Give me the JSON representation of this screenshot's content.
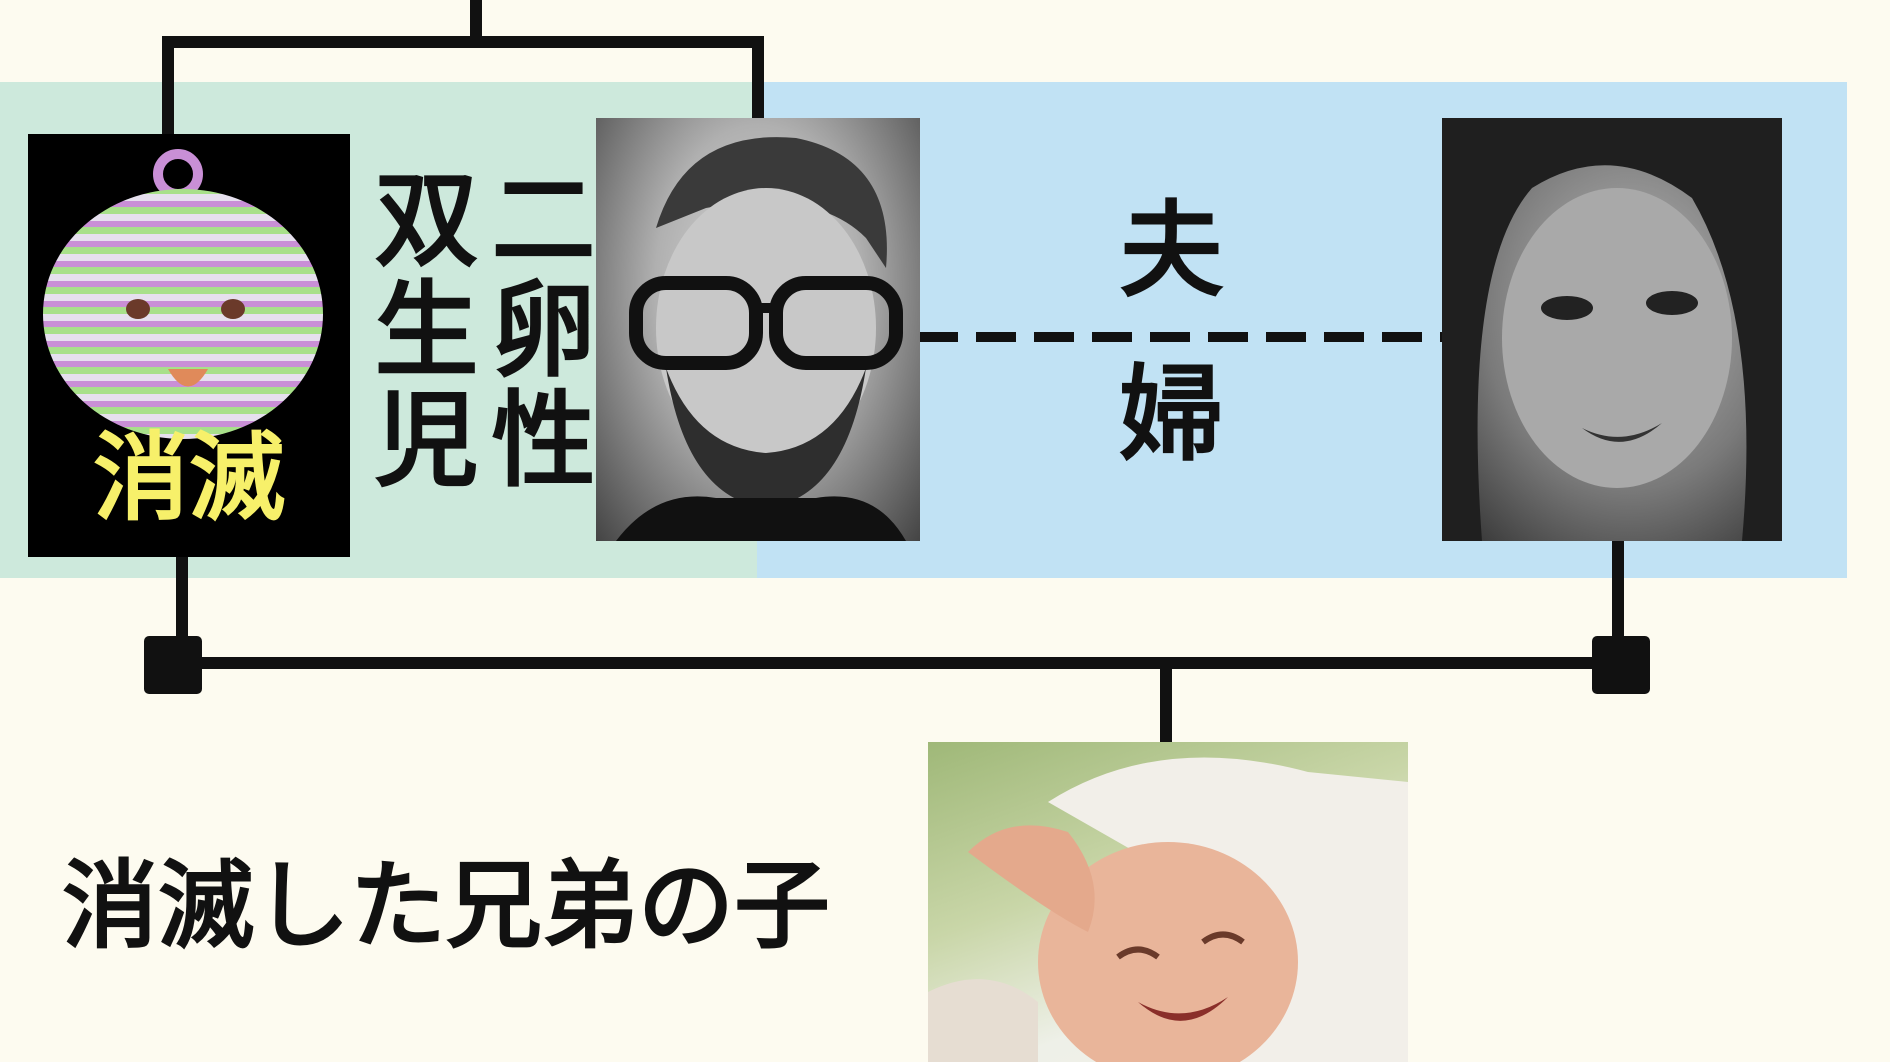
{
  "labels": {
    "dizygotic_twin": [
      "二卵性",
      "双生児"
    ],
    "vanished": "消滅",
    "married_couple": "夫婦",
    "caption": "消滅した兄弟の子"
  },
  "icons": {
    "vanished_twin": "baby-face-icon",
    "husband": "man-photo",
    "wife": "woman-photo",
    "child": "baby-photo"
  },
  "colors": {
    "background": "#fdfbf0",
    "twin_band": "#cde9dc",
    "couple_band": "#c1e2f4",
    "vanished_label": "#f7f06a",
    "lines": "#111111"
  }
}
